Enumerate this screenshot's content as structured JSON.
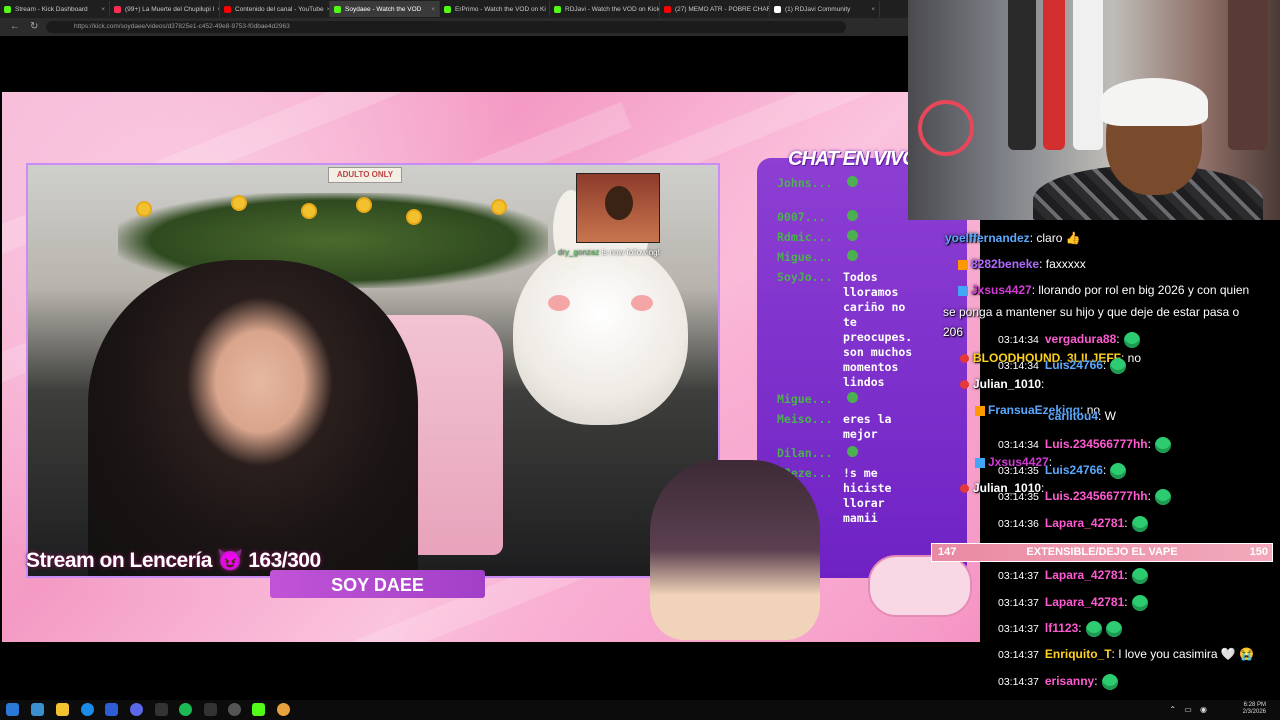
{
  "browser": {
    "tabs": [
      {
        "label": "Stream - Kick Dashboard",
        "color": "#53fc18",
        "active": false
      },
      {
        "label": "(99+) La Muerte del Chupilupi l",
        "color": "#ff2d55",
        "active": false
      },
      {
        "label": "Contenido del canal - YouTube",
        "color": "#ff0000",
        "active": false
      },
      {
        "label": "Soydaee - Watch the VOD",
        "color": "#53fc18",
        "active": true
      },
      {
        "label": "ErPrimo - Watch the VOD on Ki",
        "color": "#53fc18",
        "active": false
      },
      {
        "label": "RDJavi - Watch the VOD on Kick",
        "color": "#53fc18",
        "active": false
      },
      {
        "label": "(27) MEMO ATR - POBRE CHAR",
        "color": "#ff0000",
        "active": false
      },
      {
        "label": "(1) RDJavi Community",
        "color": "#ffffff",
        "active": false
      }
    ],
    "url": "https://kick.com/soydaee/videos/d37825e1-c452-49e8-9753-f0dbae4d2963"
  },
  "stream": {
    "goal_text": "Stream on Lencería",
    "goal_icon": "😈",
    "goal_count": "163/300",
    "name_plate": "SOY DAEE",
    "follow_user": "dry_gonzaz",
    "follow_text": "is now following!",
    "chat_title": "CHAT EN VIVO",
    "overlay_chat": [
      {
        "user": "Johns...",
        "text": ""
      },
      {
        "user": "0007...",
        "text": ""
      },
      {
        "user": "Rdmic...",
        "text": ""
      },
      {
        "user": "Migue...",
        "text": ""
      },
      {
        "user": "SoyJo...",
        "text": "Todos\nlloramos\ncariño no\nte\npreocupes.\nson muchos\nmomentos\nlindos"
      },
      {
        "user": "Migue...",
        "text": ""
      },
      {
        "user": "Meiso...",
        "text": "eres la\nmejor"
      },
      {
        "user": "Dilan...",
        "text": ""
      },
      {
        "user": "WJeze...",
        "text": "!s me\nhiciste\nllorar\nmamii"
      }
    ]
  },
  "side_chat": [
    {
      "time": "",
      "user": "yoelffernandez",
      "text": ": claro 👍",
      "color": "#5aa9ff"
    },
    {
      "time": "",
      "user": "8282beneke",
      "text": ": faxxxxx",
      "color": "#b069ff"
    },
    {
      "time": "",
      "user": "Jxsus4427",
      "text": ": llorando por rol en big 2026 y con quien",
      "color": "#d23bd6"
    },
    {
      "time": "",
      "user": "",
      "text": "se ponga a mantener su hijo y que deje de estar pasa o",
      "color": "#ffffff"
    },
    {
      "time": "",
      "user": "",
      "text": "206",
      "color": "#ffffff"
    },
    {
      "time": "03:14:34",
      "user": "vergadura88",
      "text": ":",
      "color": "#ff5ad1"
    },
    {
      "time": "",
      "user": "BLOODHOUND_3LILJEFF",
      "text": ": no",
      "color": "#ffd21f"
    },
    {
      "time": "03:14:34",
      "user": "Luis24766",
      "text": ":",
      "color": "#5aa9ff"
    },
    {
      "time": "",
      "user": "Julian_1010",
      "text": ":",
      "color": "#ffffff"
    },
    {
      "time": "",
      "user": "FransuaEzekigg",
      "text": ": no",
      "color": "#5aa9ff"
    },
    {
      "time": "",
      "user": "carlitou4",
      "text": ": W",
      "color": "#5aa9ff"
    },
    {
      "time": "03:14:34",
      "user": "Luis.234566777hh",
      "text": ":",
      "color": "#ff5ad1"
    },
    {
      "time": "",
      "user": "Jxsus4427",
      "text": ":",
      "color": "#d23bd6"
    },
    {
      "time": "03:14:35",
      "user": "Luis24766",
      "text": ":",
      "color": "#5aa9ff"
    },
    {
      "time": "",
      "user": "Julian_1010",
      "text": ":",
      "color": "#ffffff"
    },
    {
      "time": "03:14:35",
      "user": "Luis.234566777hh",
      "text": ":",
      "color": "#ff5ad1"
    },
    {
      "time": "03:14:36",
      "user": "Lapara_42781",
      "text": ":",
      "color": "#ff5ad1"
    },
    {
      "time": "03:14:37",
      "user": "Lapara_42781",
      "text": ":",
      "color": "#ff5ad1"
    },
    {
      "time": "03:14:37",
      "user": "Lapara_42781",
      "text": ":",
      "color": "#ff5ad1"
    },
    {
      "time": "03:14:37",
      "user": "lf1123",
      "text": ":",
      "color": "#ff5ad1"
    },
    {
      "time": "03:14:37",
      "user": "Enriquito_T",
      "text": ": I love you casimira 🤍 😭",
      "color": "#ffd21f"
    },
    {
      "time": "03:14:37",
      "user": "erisanny",
      "text": ":",
      "color": "#ff5ad1"
    }
  ],
  "goal2": {
    "left": "147",
    "label": "EXTENSIBLE/DEJO EL VAPE",
    "right": "150"
  },
  "taskbar": {
    "time": "6:28 PM",
    "date": "2/3/2026"
  }
}
